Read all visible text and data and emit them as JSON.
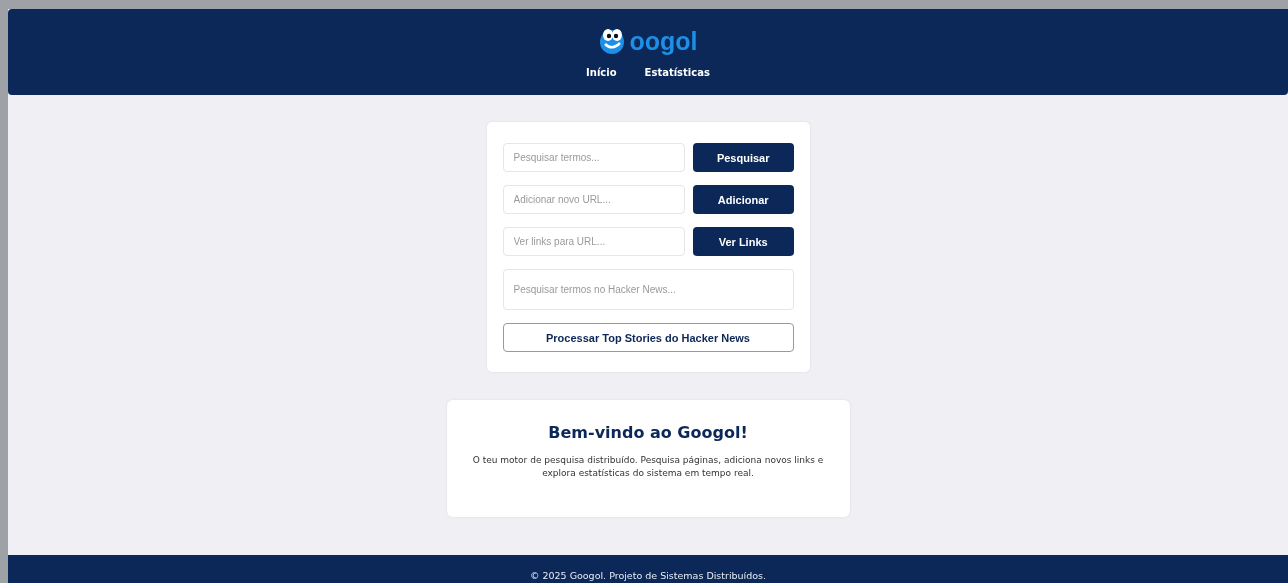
{
  "header": {
    "logo_text": "oogol",
    "nav": [
      {
        "label": "Início"
      },
      {
        "label": "Estatísticas"
      }
    ]
  },
  "search_panel": {
    "rows": [
      {
        "placeholder": "Pesquisar termos...",
        "button": "Pesquisar"
      },
      {
        "placeholder": "Adicionar novo URL...",
        "button": "Adicionar"
      },
      {
        "placeholder": "Ver links para URL...",
        "button": "Ver Links"
      }
    ],
    "hacker_news": {
      "placeholder": "Pesquisar termos no Hacker News...",
      "button": "Processar Top Stories do Hacker News"
    }
  },
  "welcome": {
    "title": "Bem-vindo ao Googol!",
    "text": "O teu motor de pesquisa distribuído. Pesquisa páginas, adiciona novos links e explora estatísticas do sistema em tempo real."
  },
  "footer": {
    "text": "© 2025 Googol. Projeto de Sistemas Distribuídos."
  }
}
